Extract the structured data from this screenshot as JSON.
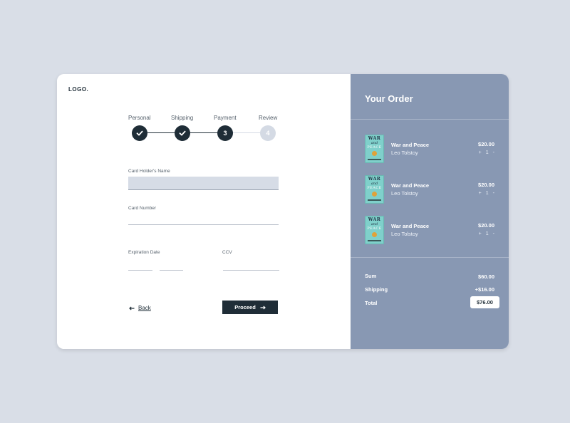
{
  "brand": {
    "logo": "LOGO."
  },
  "stepper": {
    "steps": [
      {
        "label": "Personal",
        "status": "done"
      },
      {
        "label": "Shipping",
        "status": "done"
      },
      {
        "label": "Payment",
        "status": "active",
        "number": "3"
      },
      {
        "label": "Review",
        "status": "todo",
        "number": "4"
      }
    ]
  },
  "form": {
    "card_holder_label": "Card Holder's Name",
    "card_holder_value": "",
    "card_number_label": "Card Number",
    "card_number_value": "",
    "expiration_label": "Expiration Date",
    "expiration_month": "",
    "expiration_year": "",
    "ccv_label": "CCV",
    "ccv_value": "",
    "back_label": "Back",
    "proceed_label": "Proceed"
  },
  "order": {
    "title": "Your Order",
    "items": [
      {
        "title": "War and Peace",
        "author": "Leo Tolstoy",
        "price": "$20.00",
        "qty": "1",
        "cover_text": [
          "WAR",
          "and",
          "PEACE"
        ]
      },
      {
        "title": "War and Peace",
        "author": "Leo Tolstoy",
        "price": "$20.00",
        "qty": "1",
        "cover_text": [
          "WAR",
          "and",
          "PEACE"
        ]
      },
      {
        "title": "War and Peace",
        "author": "Leo Tolstoy",
        "price": "$20.00",
        "qty": "1",
        "cover_text": [
          "WAR",
          "and",
          "PEACE"
        ]
      }
    ],
    "plus_symbol": "+",
    "minus_symbol": "-",
    "summary": {
      "sum_label": "Sum",
      "sum_value": "$60.00",
      "shipping_label": "Shipping",
      "shipping_value": "+$16.00",
      "total_label": "Total",
      "total_value": "$76.00"
    }
  },
  "colors": {
    "background": "#d9dee7",
    "primary_dark": "#1f2d37",
    "order_panel": "#8898b3",
    "input_fill": "#d6dce6"
  }
}
